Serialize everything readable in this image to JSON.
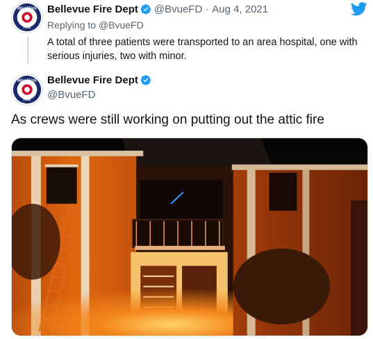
{
  "parent_tweet": {
    "author_name": "Bellevue Fire Dept",
    "handle": "@BvueFD",
    "separator": "·",
    "date": "Aug 4, 2021",
    "replying_prefix": "Replying to",
    "replying_handle": "@BvueFD",
    "text": "A total of three patients were transported to an area hospital, one with serious injuries, two with minor."
  },
  "main_tweet": {
    "author_name": "Bellevue Fire Dept",
    "handle": "@BvueFD",
    "text": "As crews were still working on putting out the attic fire",
    "media_description": "apartment-building-fire-night-photo"
  },
  "logo": {
    "badge_text_top": "BELLEVUE",
    "badge_text_bottom": "FIRE"
  },
  "colors": {
    "twitter_blue": "#1d9bf0",
    "text_primary": "#0f1419",
    "text_secondary": "#536471",
    "badge_navy": "#1a2a6c",
    "badge_red": "#c8102e"
  },
  "icons": {
    "verified": "verified-badge-icon",
    "brand": "twitter-bird-icon"
  }
}
